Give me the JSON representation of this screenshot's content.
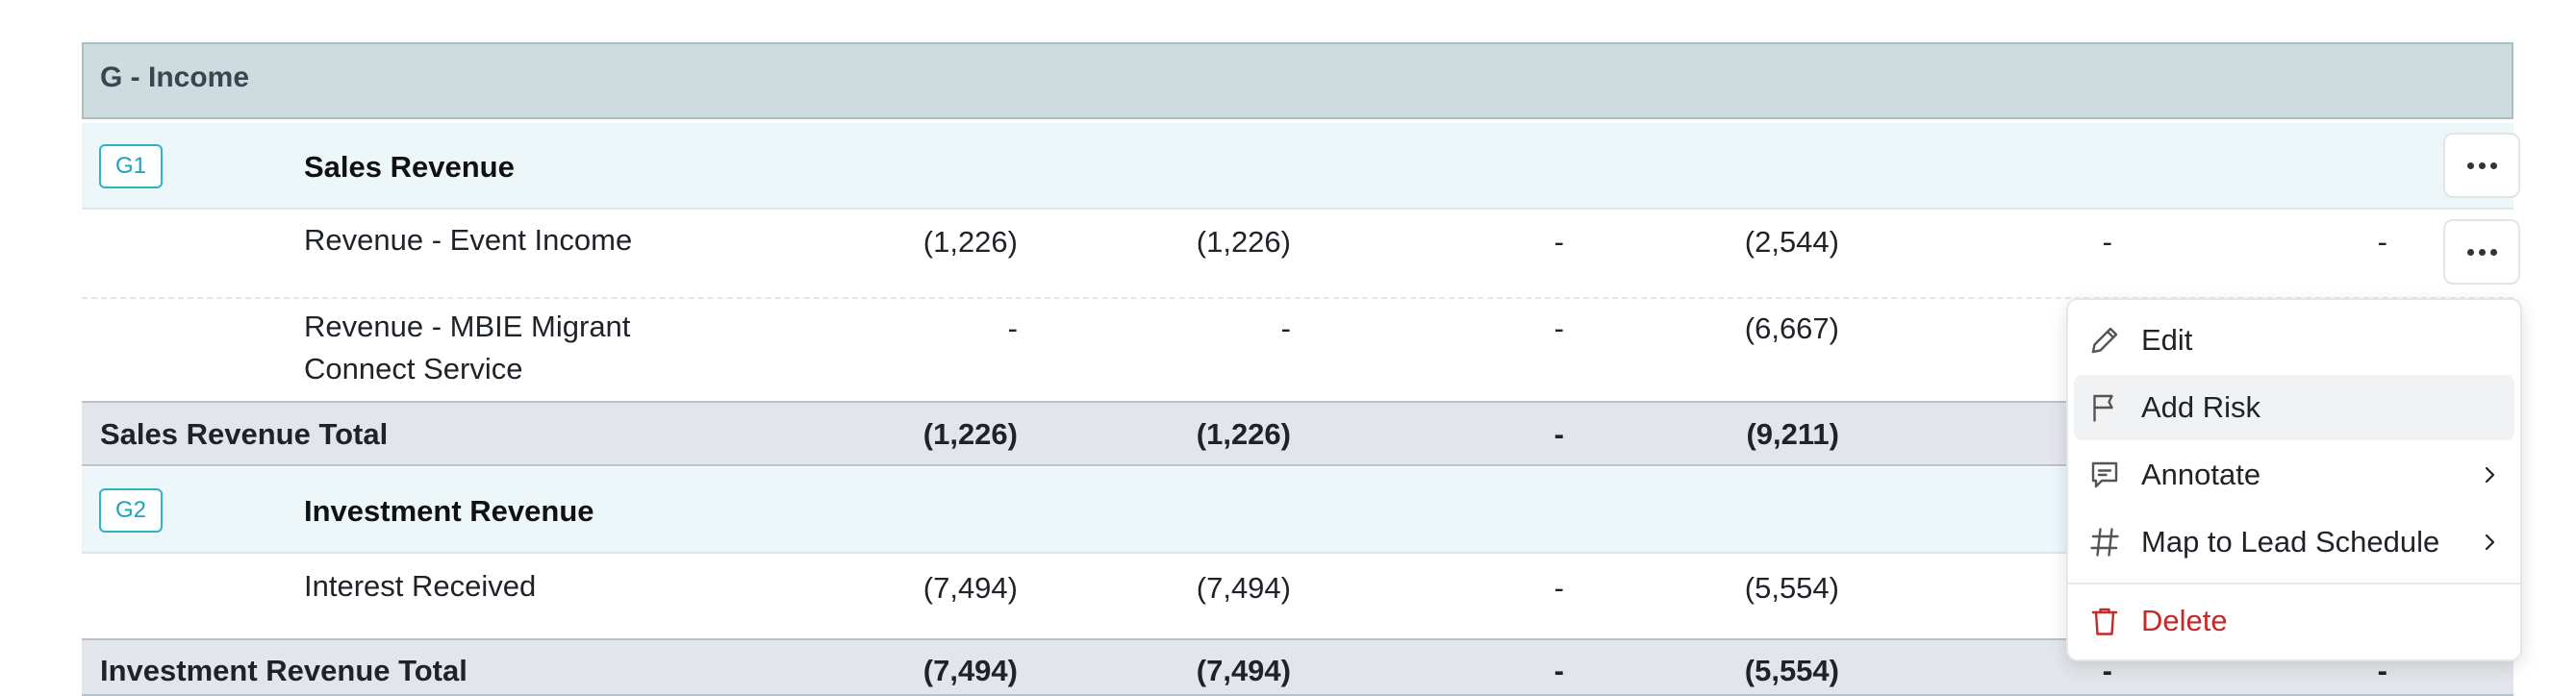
{
  "section": {
    "title": "G - Income"
  },
  "groups": [
    {
      "code": "G1",
      "title": "Sales Revenue",
      "lines": [
        {
          "label": "Revenue - Event Income",
          "values": [
            "(1,226)",
            "(1,226)",
            "-",
            "(2,544)",
            "-",
            "-"
          ]
        },
        {
          "label_line1": "Revenue - MBIE Migrant",
          "label_line2": "Connect Service",
          "values": [
            "-",
            "-",
            "-",
            "(6,667)"
          ]
        }
      ],
      "total": {
        "label": "Sales Revenue Total",
        "values": [
          "(1,226)",
          "(1,226)",
          "-",
          "(9,211)"
        ]
      }
    },
    {
      "code": "G2",
      "title": "Investment Revenue",
      "lines": [
        {
          "label": "Interest Received",
          "values": [
            "(7,494)",
            "(7,494)",
            "-",
            "(5,554)"
          ]
        }
      ],
      "total": {
        "label": "Investment Revenue Total",
        "values": [
          "(7,494)",
          "(7,494)",
          "-",
          "(5,554)",
          "-",
          "-"
        ]
      }
    }
  ],
  "menu": {
    "items": [
      {
        "label": "Edit",
        "icon": "pencil-icon"
      },
      {
        "label": "Add Risk",
        "icon": "flag-icon"
      },
      {
        "label": "Annotate",
        "icon": "comment-icon",
        "submenu": true
      },
      {
        "label": "Map to Lead Schedule",
        "icon": "hash-icon",
        "submenu": true
      },
      {
        "label": "Delete",
        "icon": "trash-icon",
        "danger": true
      }
    ]
  },
  "colors": {
    "section_bg": "#cddcdf",
    "group_bg": "#edf7f9",
    "total_bg": "#e2e6ea",
    "badge_accent": "#1aa3bd",
    "danger": "#c62828"
  }
}
